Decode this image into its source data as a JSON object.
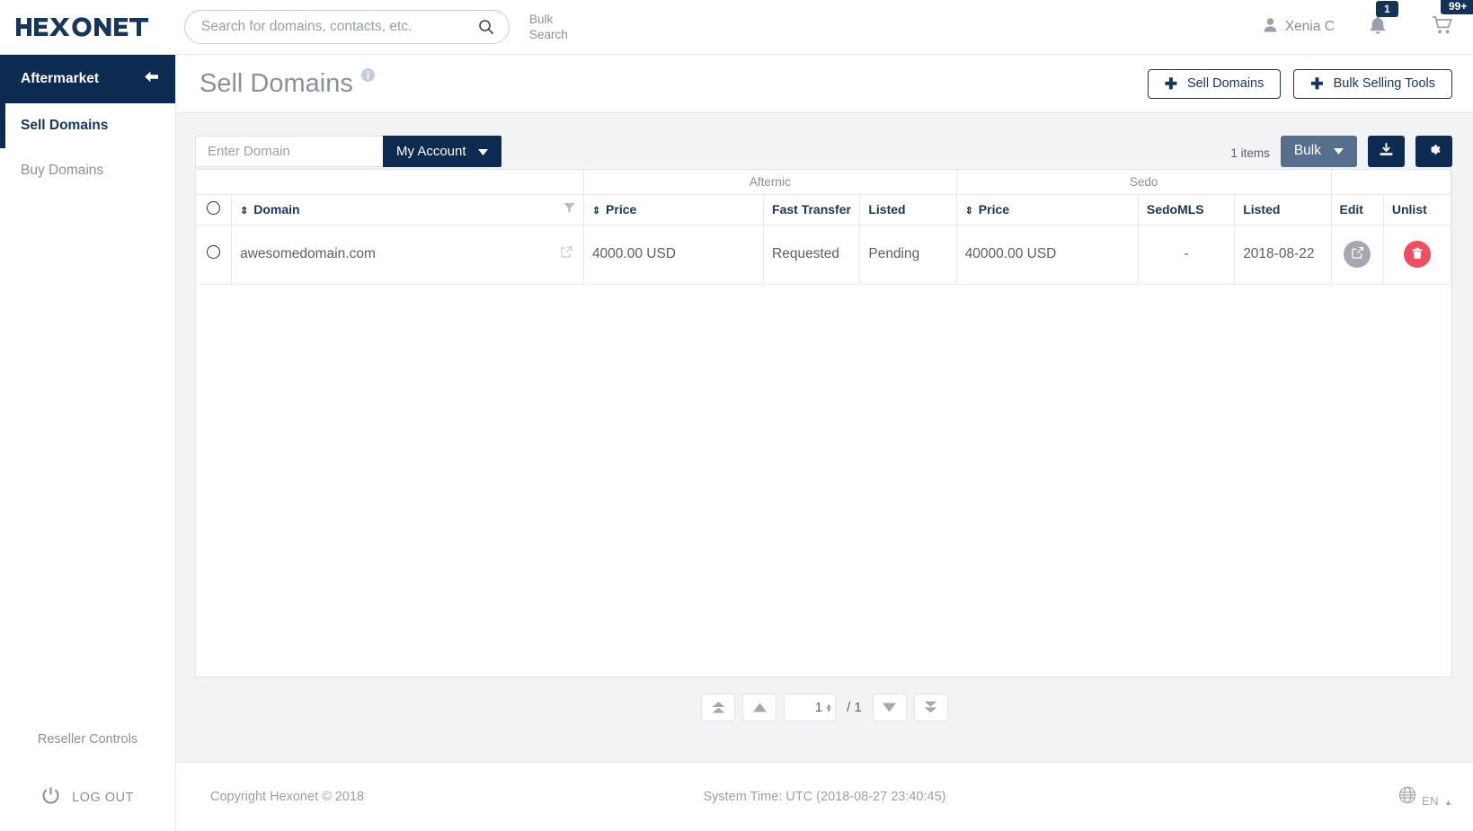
{
  "brand": {
    "logo_text": "HEXONET",
    "primary": "#0d2b51",
    "accent_red": "#ef4d60",
    "bulk_grey": "#556f8d"
  },
  "header": {
    "search": {
      "placeholder": "Search for domains, contacts, etc.",
      "value": "",
      "icon": "search-icon"
    },
    "bulk_search_line1": "Bulk",
    "bulk_search_line2": "Search",
    "user_name": "Xenia C",
    "notifications_badge": "1",
    "cart_badge": "99+"
  },
  "sidebar": {
    "title": "Aftermarket",
    "items": [
      {
        "label": "Sell Domains",
        "active": true
      },
      {
        "label": "Buy Domains",
        "active": false
      }
    ],
    "reseller_controls": "Reseller Controls",
    "logout": "LOG OUT"
  },
  "page": {
    "title": "Sell Domains",
    "actions": [
      {
        "label": "Sell Domains",
        "icon": "plus-icon"
      },
      {
        "label": "Bulk Selling Tools",
        "icon": "plus-icon"
      }
    ]
  },
  "toolbar": {
    "domain_placeholder": "Enter Domain",
    "domain_value": "",
    "account_select": "My Account",
    "items_count": "1 items",
    "bulk_label": "Bulk",
    "download_icon": "download-icon",
    "settings_icon": "gear-icon"
  },
  "table": {
    "groups": [
      {
        "label": "",
        "span": 2
      },
      {
        "label": "Afternic",
        "span": 3
      },
      {
        "label": "Sedo",
        "span": 3
      },
      {
        "label": "",
        "span": 2
      }
    ],
    "columns": [
      {
        "label": "",
        "key": "select"
      },
      {
        "label": "Domain",
        "key": "domain",
        "sortable": true,
        "filterable": true
      },
      {
        "label": "Price",
        "key": "afternic_price",
        "sortable": true
      },
      {
        "label": "Fast Transfer",
        "key": "fast_transfer"
      },
      {
        "label": "Listed",
        "key": "afternic_listed"
      },
      {
        "label": "Price",
        "key": "sedo_price",
        "sortable": true
      },
      {
        "label": "SedoMLS",
        "key": "sedomls"
      },
      {
        "label": "Listed",
        "key": "sedo_listed"
      },
      {
        "label": "Edit",
        "key": "edit"
      },
      {
        "label": "Unlist",
        "key": "unlist"
      }
    ],
    "rows": [
      {
        "domain": "awesomedomain.com",
        "afternic_price": "4000.00 USD",
        "fast_transfer": "Requested",
        "afternic_listed": "Pending",
        "sedo_price": "40000.00 USD",
        "sedomls": "-",
        "sedo_listed": "2018-08-22",
        "edit_icon": "edit-pencil-icon",
        "unlist_icon": "trash-icon"
      }
    ]
  },
  "pagination": {
    "first_icon": "double-up-arrow-icon",
    "prev_icon": "up-arrow-icon",
    "page_value": "1",
    "separator": "/ 1",
    "next_icon": "down-arrow-icon",
    "last_icon": "double-down-arrow-icon"
  },
  "footer": {
    "copyright": "Copyright Hexonet © 2018",
    "system_time": "System Time: UTC (2018-08-27 23:40:45)",
    "language": "EN",
    "globe_icon": "globe-icon"
  }
}
